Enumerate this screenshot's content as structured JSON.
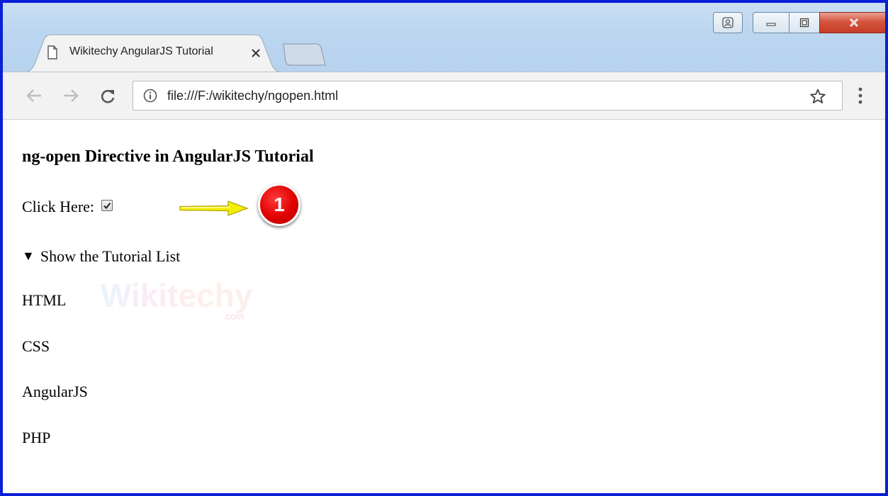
{
  "browser": {
    "tab_title": "Wikitechy AngularJS Tutorial",
    "url": "file:///F:/wikitechy/ngopen.html"
  },
  "page": {
    "heading": "ng-open Directive in AngularJS Tutorial",
    "checkbox_label": "Click Here:",
    "checkbox_checked": true,
    "summary_marker": "▼",
    "summary_text": "Show the Tutorial List",
    "list_items": [
      "HTML",
      "CSS",
      "AngularJS",
      "PHP"
    ]
  },
  "annotation": {
    "badge_number": "1",
    "arrow_color": "#f5f000",
    "badge_color": "#e00000"
  },
  "watermark": {
    "brand": "Wikitechy",
    "domain": ".com"
  },
  "colors": {
    "frame_border": "#0a1fd6",
    "titlebar": "#c9dff3",
    "toolbar": "#f2f2f2"
  }
}
